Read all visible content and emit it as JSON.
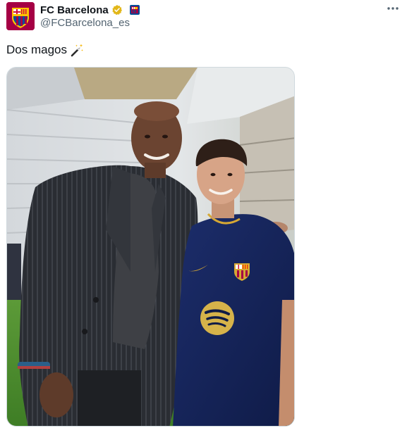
{
  "tweet": {
    "display_name": "FC Barcelona",
    "handle": "@FCBarcelona_es",
    "text": "Dos magos",
    "icons": {
      "verified": "verified-gold-badge-icon",
      "affiliation": "fc-barcelona-crest-icon",
      "more": "more-horizontal-icon",
      "wand": "magic-wand-icon"
    },
    "colors": {
      "verified_gold": "#e2b719",
      "secondary_text": "#536471",
      "barca_blaugrana_red": "#a50044",
      "barca_blue": "#004d98"
    }
  }
}
